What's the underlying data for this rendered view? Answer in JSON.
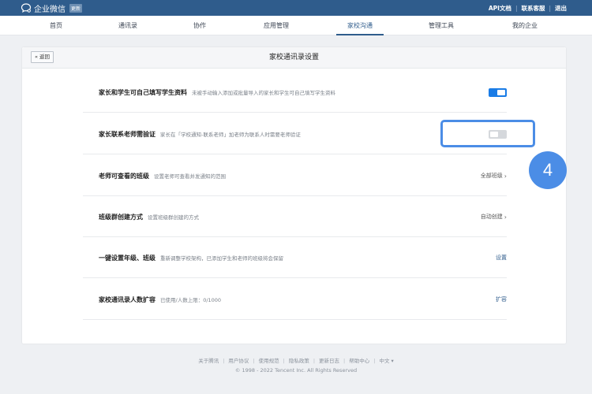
{
  "topbar": {
    "brand": "企业微信",
    "badge": "更新",
    "links": [
      "API文档",
      "联系客服",
      "退出"
    ]
  },
  "nav": {
    "items": [
      "首页",
      "通讯录",
      "协作",
      "应用管理",
      "家校沟通",
      "管理工具",
      "我的企业"
    ],
    "active": "家校沟通"
  },
  "card": {
    "back": "« 返回",
    "title": "家校通讯录设置"
  },
  "rows": [
    {
      "title": "家长和学生可自己填写学生资料",
      "desc": "未被手动输入添加或批量导入的家长和学生可自己填写学生资料",
      "toggle": "on"
    },
    {
      "title": "家长联系老师需验证",
      "desc": "家长在「学校通知-联系老师」加老师为联系人时需要老师验证",
      "toggle": "off"
    },
    {
      "title": "老师可查看的班级",
      "desc": "设置老师可查看并发通知的范围",
      "action": "全部班级"
    },
    {
      "title": "班级群创建方式",
      "desc": "设置班级群创建的方式",
      "action": "自动创建"
    },
    {
      "title": "一键设置年级、班级",
      "desc": "重新调整学校架构，已添加学生和老师的班级将会保留",
      "action": "设置"
    },
    {
      "title": "家校通讯录人数扩容",
      "desc": "已使用/人数上限：0/1000",
      "action": "扩容"
    }
  ],
  "step": "4",
  "footer": {
    "links": [
      "关于腾讯",
      "用户协议",
      "使用规范",
      "隐私政策",
      "更新日志",
      "帮助中心",
      "中文 ▾"
    ],
    "copyright": "© 1998 - 2022 Tencent Inc. All Rights Reserved"
  },
  "colors": {
    "brand": "#2f5c8c",
    "accent": "#1a7ce6",
    "highlight": "#4b8de6"
  },
  "icons": [
    "chat-bubble-logo-icon",
    "chevron-right-icon"
  ]
}
